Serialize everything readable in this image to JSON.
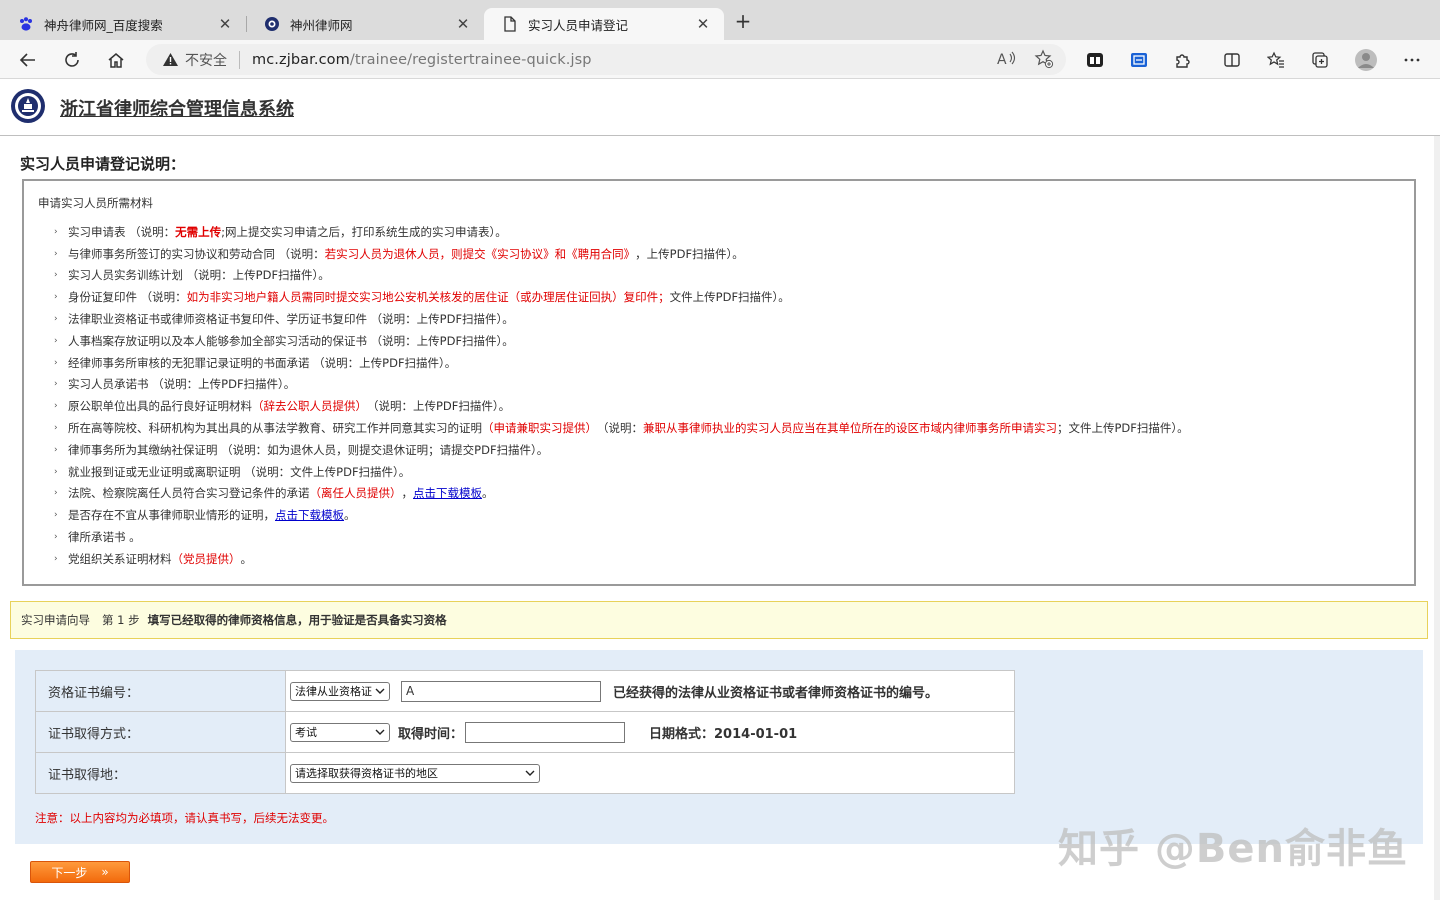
{
  "browser": {
    "tabs": [
      {
        "title": "神舟律师网_百度搜索",
        "icon": "baidu-paw-icon"
      },
      {
        "title": "神州律师网",
        "icon": "site-logo-icon"
      },
      {
        "title": "实习人员申请登记",
        "icon": "document-icon"
      }
    ],
    "security_label": "不安全",
    "url_host": "mc.zjbar.com",
    "url_path": "/trainee/registertrainee-quick.jsp"
  },
  "site": {
    "title": "浙江省律师综合管理信息系统"
  },
  "instructions": {
    "title": "实习人员申请登记说明：",
    "heading": "申请实习人员所需材料",
    "items": [
      {
        "a": "实习申请表 （说明：",
        "r": "无需上传",
        "b": ";网上提交实习申请之后，打印系统生成的实习申请表）。"
      },
      {
        "a": "与律师事务所签订的实习协议和劳动合同 （说明：",
        "r": "若实习人员为退休人员，则提交《实习协议》和《聘用合同》",
        "b": "，上传PDF扫描件）。"
      },
      {
        "a": "实习人员实务训练计划 （说明：上传PDF扫描件）。"
      },
      {
        "a": "身份证复印件 （说明：",
        "r": "如为非实习地户籍人员需同时提交实习地公安机关核发的居住证（或办理居住证回执）复印件；",
        "b": "文件上传PDF扫描件）。"
      },
      {
        "a": "法律职业资格证书或律师资格证书复印件、学历证书复印件 （说明：上传PDF扫描件）。"
      },
      {
        "a": "人事档案存放证明以及本人能够参加全部实习活动的保证书 （说明：上传PDF扫描件）。"
      },
      {
        "a": "经律师事务所审核的无犯罪记录证明的书面承诺 （说明：上传PDF扫描件）。"
      },
      {
        "a": "实习人员承诺书 （说明：上传PDF扫描件）。"
      },
      {
        "a": "原公职单位出具的品行良好证明材料",
        "r": "（辞去公职人员提供）",
        "b": " （说明：上传PDF扫描件）。"
      },
      {
        "a": "所在高等院校、科研机构为其出具的从事法学教育、研究工作并同意其实习的证明",
        "r": "（申请兼职实习提供）",
        "b": " （说明：",
        "r2": "兼职从事律师执业的实习人员应当在其单位所在的设区市域内律师事务所申请实习",
        "c": "；文件上传PDF扫描件）。"
      },
      {
        "a": "律师事务所为其缴纳社保证明 （说明：如为退休人员，则提交退休证明；请提交PDF扫描件）。"
      },
      {
        "a": "就业报到证或无业证明或离职证明 （说明：文件上传PDF扫描件）。"
      },
      {
        "a": "法院、检察院离任人员符合实习登记条件的承诺",
        "r": "（离任人员提供）",
        "b": "，",
        "link": "点击下载模板",
        "c": "。"
      },
      {
        "a": "是否存在不宜从事律师职业情形的证明，",
        "link": "点击下载模板",
        "c": "。"
      },
      {
        "a": "律所承诺书 。"
      },
      {
        "a": "党组织关系证明材料",
        "r": "（党员提供）",
        "b": " 。"
      }
    ]
  },
  "guide": {
    "label": "实习申请向导",
    "step": "第 1 步",
    "desc": "填写已经取得的律师资格信息，用于验证是否具备实习资格"
  },
  "form": {
    "rows": [
      {
        "label": "资格证书编号："
      },
      {
        "label": "证书取得方式："
      },
      {
        "label": "证书取得地："
      }
    ],
    "cert_type_value": "法律从业资格证",
    "cert_number_value": "A",
    "cert_number_hint": "已经获得的法律从业资格证书或者律师资格证书的编号。",
    "method_value": "考试",
    "time_label": "取得时间：",
    "time_value": "",
    "date_format_hint": "日期格式：2014-01-01",
    "region_value": "请选择取获得资格证书的地区",
    "note": "注意：以上内容均为必填项，请认真书写，后续无法变更。"
  },
  "next_button": {
    "label": "下一步",
    "arrows": "»"
  },
  "watermark": "知乎 @Ben俞非鱼"
}
